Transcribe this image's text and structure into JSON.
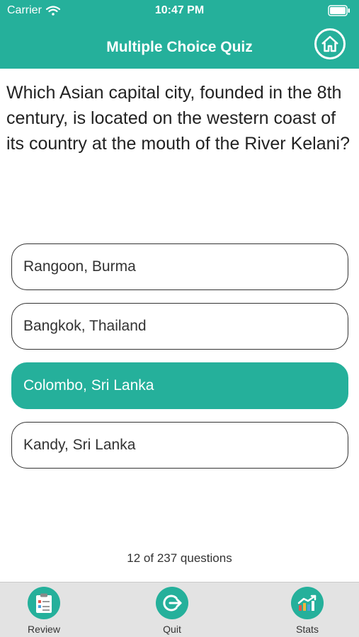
{
  "status_bar": {
    "carrier": "Carrier",
    "time": "10:47 PM"
  },
  "header": {
    "title": "Multiple Choice Quiz",
    "home_icon": "home-icon"
  },
  "question": {
    "text": "Which Asian capital city, founded in the 8th century, is located on the western coast of its country at the mouth of the River Kelani?"
  },
  "answers": [
    {
      "label": "Rangoon, Burma",
      "selected": false
    },
    {
      "label": "Bangkok, Thailand",
      "selected": false
    },
    {
      "label": "Colombo, Sri Lanka",
      "selected": true
    },
    {
      "label": "Kandy, Sri Lanka",
      "selected": false
    }
  ],
  "progress": {
    "text": "12 of 237 questions"
  },
  "tabbar": {
    "items": [
      {
        "label": "Review",
        "icon": "clipboard-icon"
      },
      {
        "label": "Quit",
        "icon": "exit-icon"
      },
      {
        "label": "Stats",
        "icon": "chart-icon"
      }
    ]
  },
  "colors": {
    "accent": "#25b09b",
    "tabbar_bg": "#e3e3e3"
  }
}
